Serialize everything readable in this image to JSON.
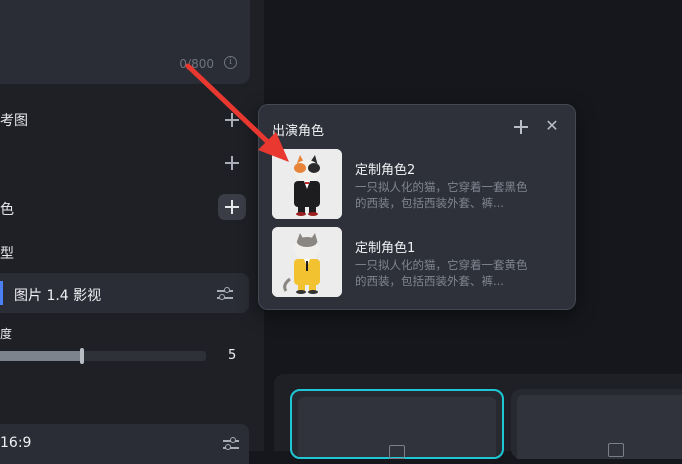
{
  "settings": {
    "char_counter": "0/800",
    "rows": [
      {
        "label": "考图"
      },
      {
        "label": "色"
      },
      {
        "label": "型"
      },
      {
        "label": "度"
      }
    ],
    "model": {
      "label": "图片 1.4 影视"
    },
    "slider": {
      "value_label": "5",
      "fraction": 0.4
    },
    "ratio": {
      "label": "16:9"
    }
  },
  "popover": {
    "title": "出演角色",
    "characters": [
      {
        "name": "定制角色2",
        "description": "一只拟人化的猫，它穿着一套黑色的西装，包括西装外套、裤..."
      },
      {
        "name": "定制角色1",
        "description": "一只拟人化的猫，它穿着一套黄色的西装，包括西装外套、裤..."
      }
    ]
  },
  "colors": {
    "accent_blue": "#4a7ff5",
    "selection_cyan": "#1fc7d4",
    "annotation_arrow": "#e8382f"
  },
  "icons": [
    "info-icon",
    "plus-icon",
    "sliders-icon",
    "close-icon",
    "image-icon"
  ]
}
